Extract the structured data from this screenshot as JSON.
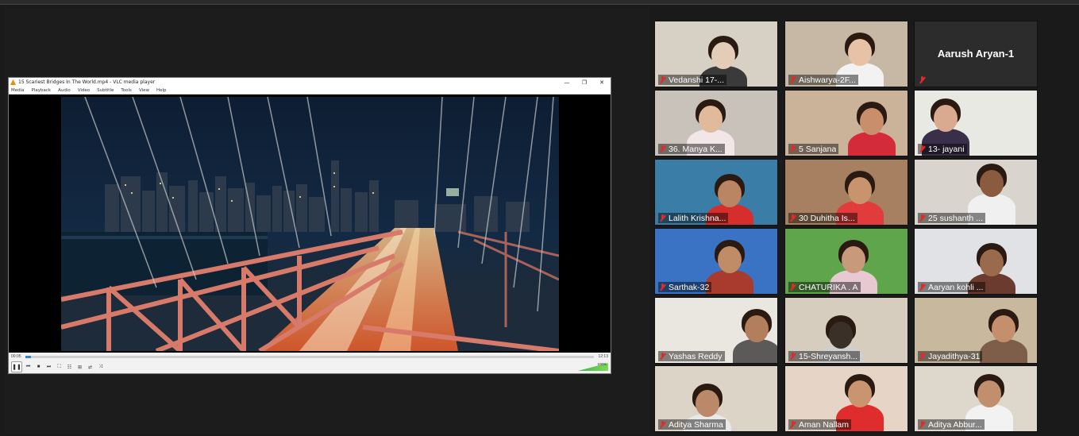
{
  "vlc": {
    "title": "15 Scariest Bridges In The World.mp4 - VLC media player",
    "window_buttons": [
      "—",
      "❐",
      "✕"
    ],
    "menu": [
      "Media",
      "Playback",
      "Audio",
      "Video",
      "Subtitle",
      "Tools",
      "View",
      "Help"
    ],
    "time_elapsed": "00:05",
    "time_total": "12:13",
    "seek_progress": 0.01,
    "volume_label": "100%",
    "controls": [
      "⏮",
      "■",
      "⏭",
      "⛶",
      "☷",
      "⊞",
      "⇄",
      "⤨"
    ]
  },
  "participants": [
    {
      "name": "Vedanshi 17-...",
      "muted": true
    },
    {
      "name": "Aishwarya-2F...",
      "muted": true
    },
    {
      "name": "Aarush Aryan-1",
      "muted": true,
      "video": false
    },
    {
      "name": "36. Manya K...",
      "muted": true
    },
    {
      "name": "5 Sanjana",
      "muted": true
    },
    {
      "name": "13- jayani",
      "muted": true
    },
    {
      "name": "Lalith Krishna...",
      "muted": true
    },
    {
      "name": "30 Duhitha Is...",
      "muted": true
    },
    {
      "name": "25 sushanth ...",
      "muted": true
    },
    {
      "name": "Sarthak-32",
      "muted": true
    },
    {
      "name": "CHATURIKA . A",
      "muted": true
    },
    {
      "name": "Aaryan kohli ...",
      "muted": true
    },
    {
      "name": "Yashas Reddy",
      "muted": true
    },
    {
      "name": "15-Shreyansh...",
      "muted": true
    },
    {
      "name": "Jayadithya-31",
      "muted": true
    },
    {
      "name": "Aditya Sharma",
      "muted": true
    },
    {
      "name": "Aman Nallam",
      "muted": true
    },
    {
      "name": "Aditya Abbur...",
      "muted": true
    }
  ],
  "colors": {
    "mute_red": "#e02b2b",
    "vlc_orange": "#f08a00"
  }
}
